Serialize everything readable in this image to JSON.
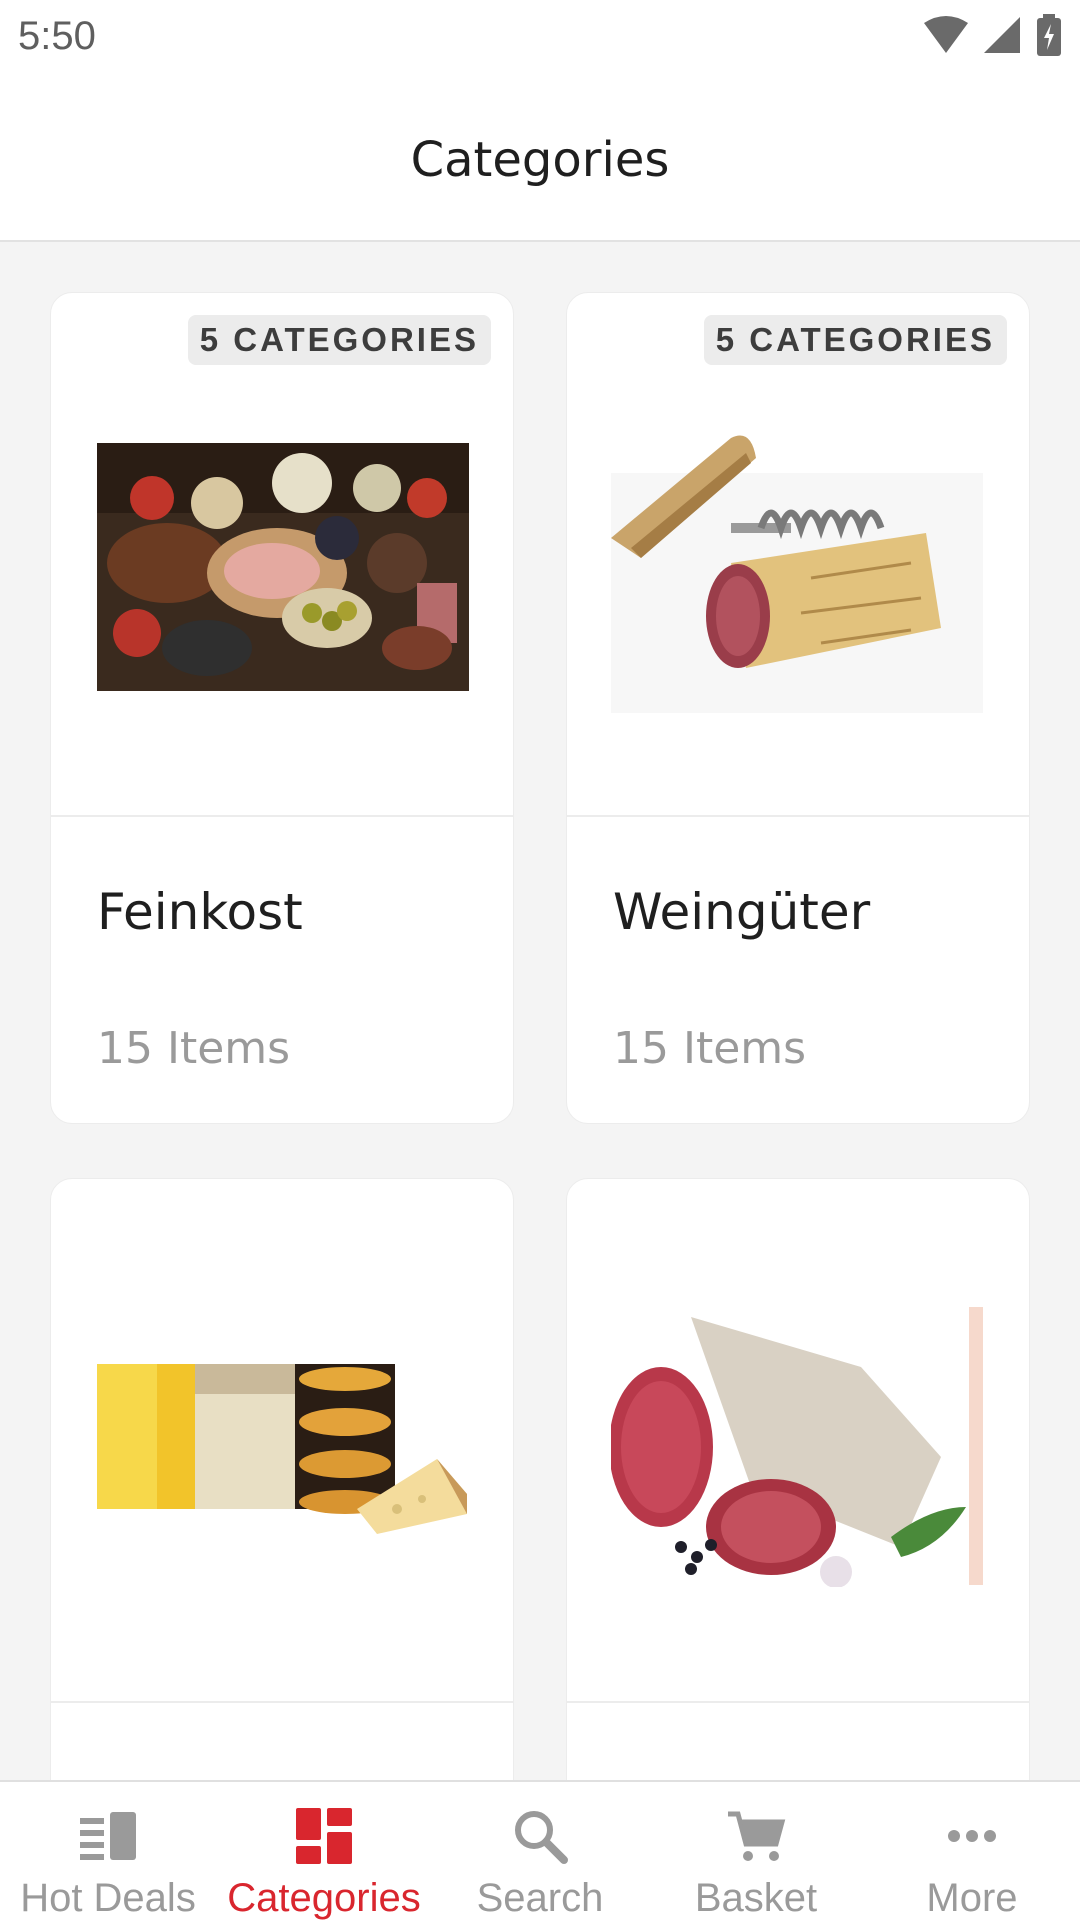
{
  "status_bar": {
    "time": "5:50"
  },
  "header": {
    "title": "Categories"
  },
  "categories": [
    {
      "badge": "5 CATEGORIES",
      "name": "Feinkost",
      "count": "15 Items",
      "image": "antipasti-platter"
    },
    {
      "badge": "5 CATEGORIES",
      "name": "Weingüter",
      "count": "15 Items",
      "image": "corkscrew-cork"
    },
    {
      "badge": "",
      "name": "",
      "count": "",
      "image": "cheese-wheels"
    },
    {
      "badge": "",
      "name": "",
      "count": "",
      "image": "salami"
    }
  ],
  "tabbar": {
    "tabs": [
      {
        "label": "Hot Deals",
        "icon": "list-icon",
        "active": false
      },
      {
        "label": "Categories",
        "icon": "grid-icon",
        "active": true
      },
      {
        "label": "Search",
        "icon": "search-icon",
        "active": false
      },
      {
        "label": "Basket",
        "icon": "cart-icon",
        "active": false
      },
      {
        "label": "More",
        "icon": "more-icon",
        "active": false
      }
    ]
  },
  "colors": {
    "accent": "#d9262e",
    "inactive": "#9a9a9a",
    "background": "#f4f4f4"
  }
}
